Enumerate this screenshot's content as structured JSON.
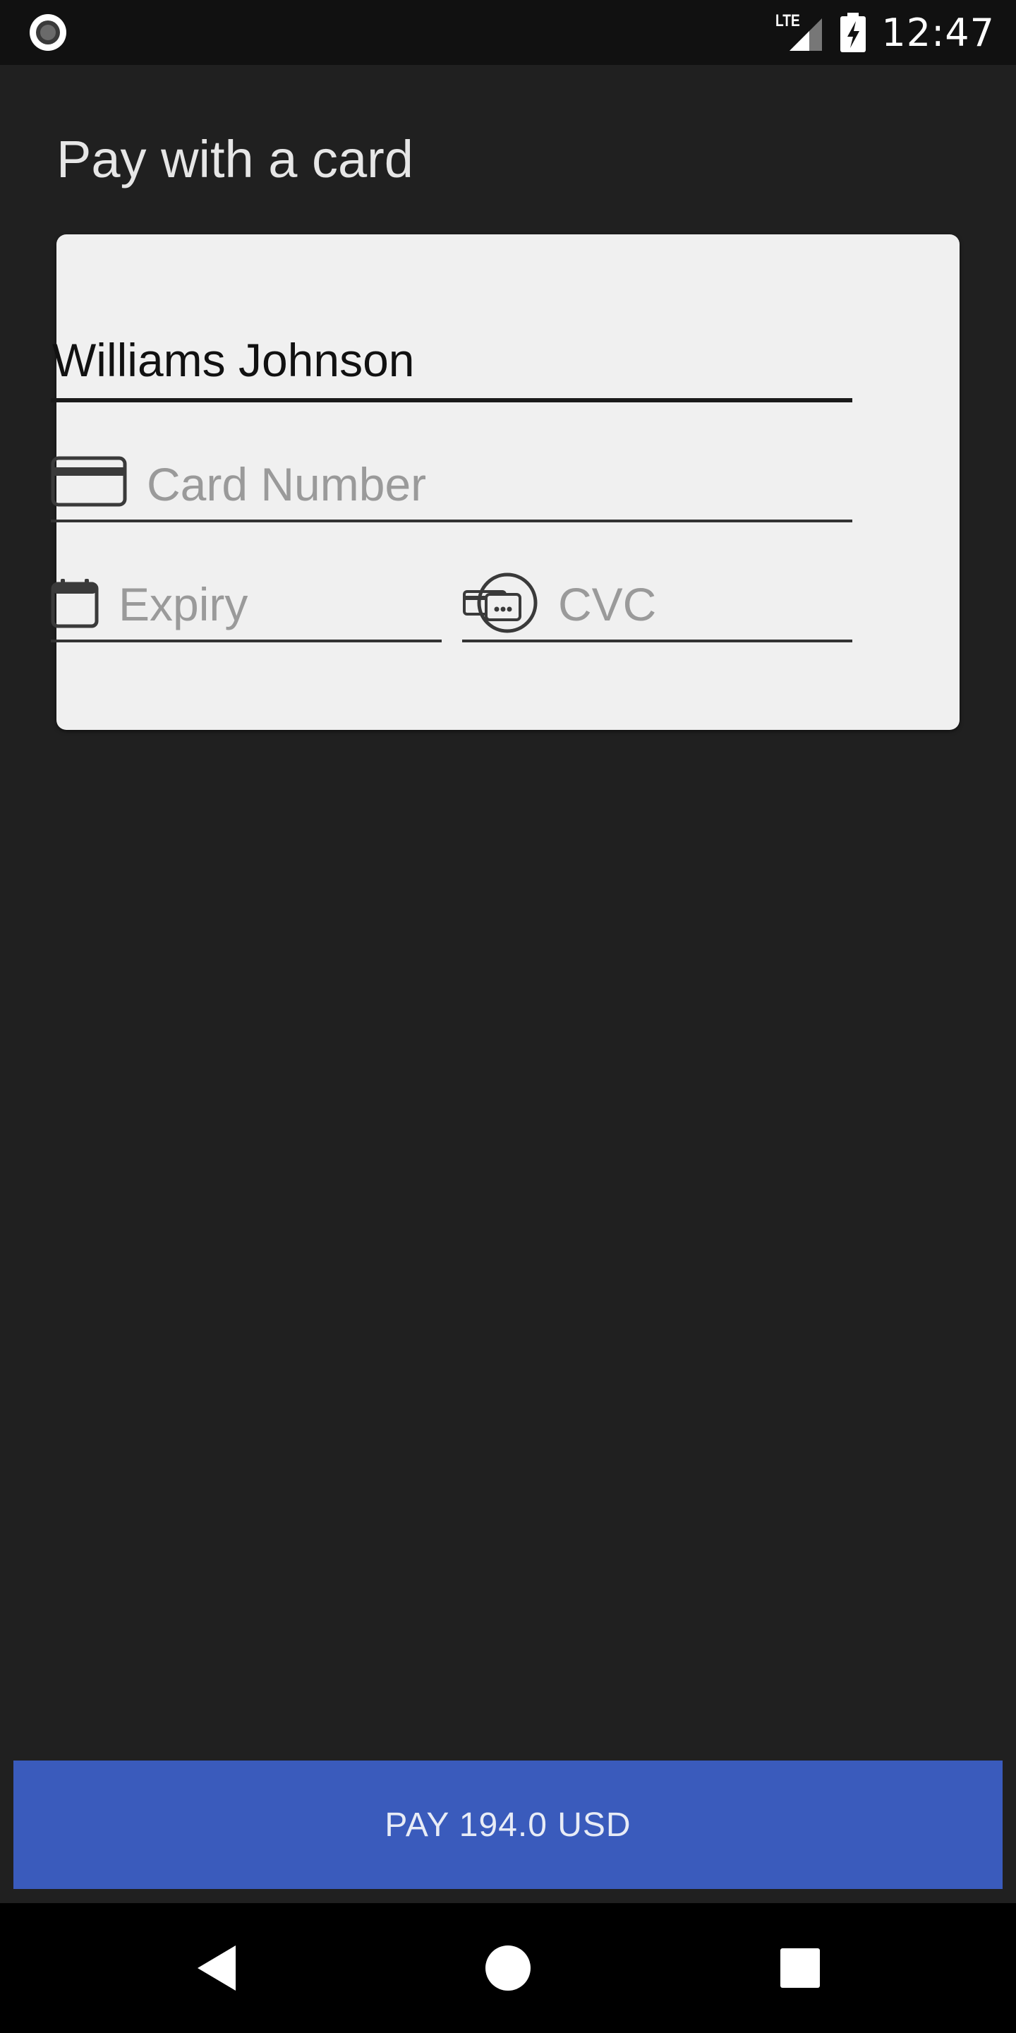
{
  "status_bar": {
    "time": "12:47",
    "network_label": "LTE",
    "icons": {
      "left": "recording-indicator-icon",
      "signal": "signal-icon",
      "battery": "battery-charging-icon"
    }
  },
  "page": {
    "title": "Pay with a card"
  },
  "form": {
    "name": {
      "value": "Williams Johnson"
    },
    "card_number": {
      "value": "",
      "placeholder": "Card Number",
      "icon": "credit-card-icon"
    },
    "expiry": {
      "value": "",
      "placeholder": "Expiry",
      "icon": "calendar-icon"
    },
    "cvc": {
      "value": "",
      "placeholder": "CVC",
      "icon": "card-cvc-icon"
    }
  },
  "pay_button": {
    "label": "PAY 194.0 USD"
  },
  "nav_bar": {
    "back": "back-icon",
    "home": "home-icon",
    "recents": "recents-icon"
  },
  "colors": {
    "background": "#202020",
    "card_background": "#f0f0f0",
    "button": "#3a5bbc",
    "status_bar": "#111111",
    "nav_bar": "#000000"
  }
}
